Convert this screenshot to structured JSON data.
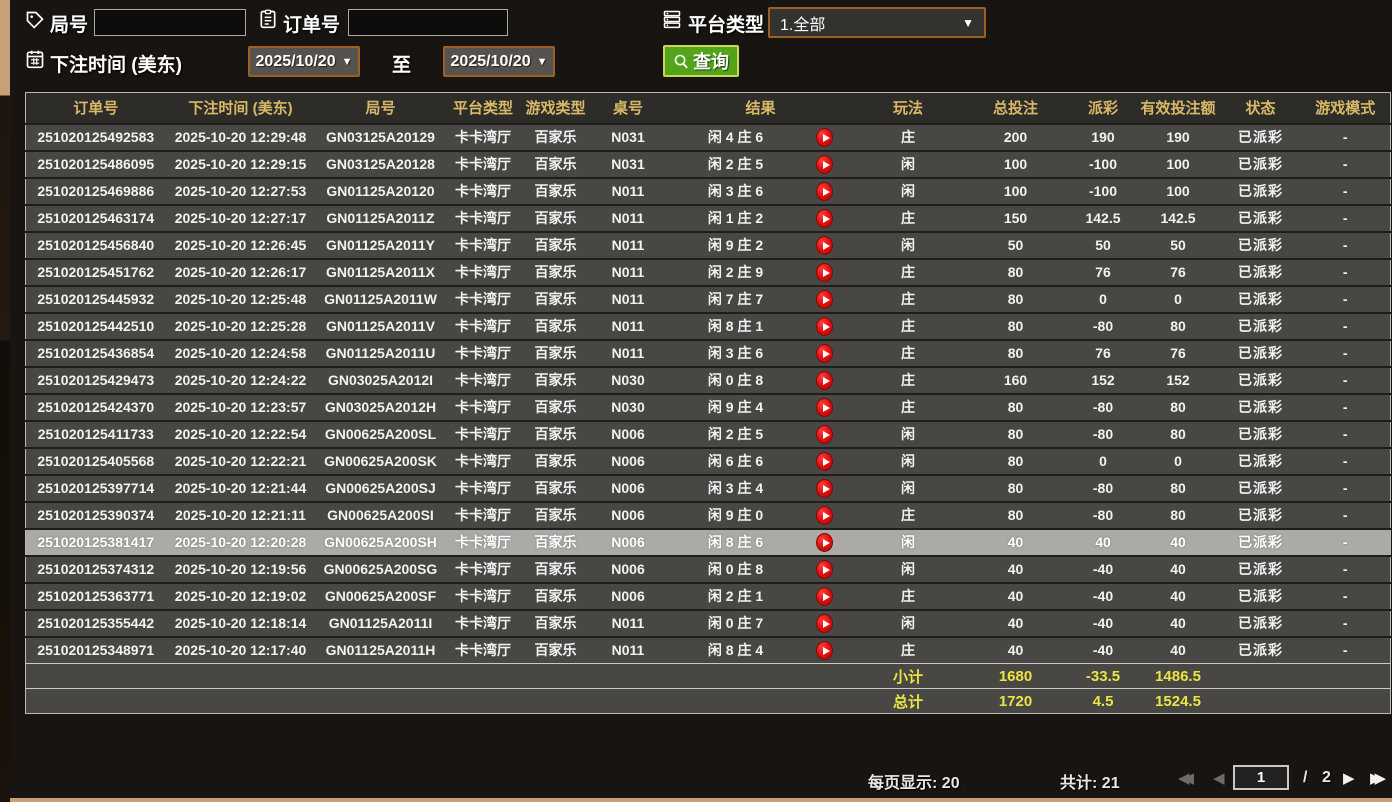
{
  "filters": {
    "game_no_label": "局号",
    "game_no_value": "",
    "order_no_label": "订单号",
    "order_no_value": "",
    "platform_label": "平台类型",
    "platform_value": "1.全部",
    "platform_caret": "▼",
    "bet_time_label": "下注时间 (美东)",
    "date_from": "2025/10/20",
    "date_to": "2025/10/20",
    "date_caret": "▼",
    "to_label": "至",
    "query_label": "查询"
  },
  "table": {
    "headers": [
      "订单号",
      "下注时间 (美东)",
      "局号",
      "平台类型",
      "游戏类型",
      "桌号",
      "结果",
      "玩法",
      "总投注",
      "派彩",
      "有效投注额",
      "状态",
      "游戏模式"
    ],
    "selected_row_index": 15,
    "rows": [
      {
        "order": "251020125492583",
        "time": "2025-10-20 12:29:48",
        "game_no": "GN03125A20129",
        "platform": "卡卡湾厅",
        "game_type": "百家乐",
        "table_no": "N031",
        "result": "闲 4 庄 6",
        "bet": "庄",
        "total_bet": "200",
        "payout": "190",
        "valid_bet": "190",
        "status": "已派彩",
        "mode": "-"
      },
      {
        "order": "251020125486095",
        "time": "2025-10-20 12:29:15",
        "game_no": "GN03125A20128",
        "platform": "卡卡湾厅",
        "game_type": "百家乐",
        "table_no": "N031",
        "result": "闲 2 庄 5",
        "bet": "闲",
        "total_bet": "100",
        "payout": "-100",
        "valid_bet": "100",
        "status": "已派彩",
        "mode": "-"
      },
      {
        "order": "251020125469886",
        "time": "2025-10-20 12:27:53",
        "game_no": "GN01125A20120",
        "platform": "卡卡湾厅",
        "game_type": "百家乐",
        "table_no": "N011",
        "result": "闲 3 庄 6",
        "bet": "闲",
        "total_bet": "100",
        "payout": "-100",
        "valid_bet": "100",
        "status": "已派彩",
        "mode": "-"
      },
      {
        "order": "251020125463174",
        "time": "2025-10-20 12:27:17",
        "game_no": "GN01125A2011Z",
        "platform": "卡卡湾厅",
        "game_type": "百家乐",
        "table_no": "N011",
        "result": "闲 1 庄 2",
        "bet": "庄",
        "total_bet": "150",
        "payout": "142.5",
        "valid_bet": "142.5",
        "status": "已派彩",
        "mode": "-"
      },
      {
        "order": "251020125456840",
        "time": "2025-10-20 12:26:45",
        "game_no": "GN01125A2011Y",
        "platform": "卡卡湾厅",
        "game_type": "百家乐",
        "table_no": "N011",
        "result": "闲 9 庄 2",
        "bet": "闲",
        "total_bet": "50",
        "payout": "50",
        "valid_bet": "50",
        "status": "已派彩",
        "mode": "-"
      },
      {
        "order": "251020125451762",
        "time": "2025-10-20 12:26:17",
        "game_no": "GN01125A2011X",
        "platform": "卡卡湾厅",
        "game_type": "百家乐",
        "table_no": "N011",
        "result": "闲 2 庄 9",
        "bet": "庄",
        "total_bet": "80",
        "payout": "76",
        "valid_bet": "76",
        "status": "已派彩",
        "mode": "-"
      },
      {
        "order": "251020125445932",
        "time": "2025-10-20 12:25:48",
        "game_no": "GN01125A2011W",
        "platform": "卡卡湾厅",
        "game_type": "百家乐",
        "table_no": "N011",
        "result": "闲 7 庄 7",
        "bet": "庄",
        "total_bet": "80",
        "payout": "0",
        "valid_bet": "0",
        "status": "已派彩",
        "mode": "-"
      },
      {
        "order": "251020125442510",
        "time": "2025-10-20 12:25:28",
        "game_no": "GN01125A2011V",
        "platform": "卡卡湾厅",
        "game_type": "百家乐",
        "table_no": "N011",
        "result": "闲 8 庄 1",
        "bet": "庄",
        "total_bet": "80",
        "payout": "-80",
        "valid_bet": "80",
        "status": "已派彩",
        "mode": "-"
      },
      {
        "order": "251020125436854",
        "time": "2025-10-20 12:24:58",
        "game_no": "GN01125A2011U",
        "platform": "卡卡湾厅",
        "game_type": "百家乐",
        "table_no": "N011",
        "result": "闲 3 庄 6",
        "bet": "庄",
        "total_bet": "80",
        "payout": "76",
        "valid_bet": "76",
        "status": "已派彩",
        "mode": "-"
      },
      {
        "order": "251020125429473",
        "time": "2025-10-20 12:24:22",
        "game_no": "GN03025A2012I",
        "platform": "卡卡湾厅",
        "game_type": "百家乐",
        "table_no": "N030",
        "result": "闲 0 庄 8",
        "bet": "庄",
        "total_bet": "160",
        "payout": "152",
        "valid_bet": "152",
        "status": "已派彩",
        "mode": "-"
      },
      {
        "order": "251020125424370",
        "time": "2025-10-20 12:23:57",
        "game_no": "GN03025A2012H",
        "platform": "卡卡湾厅",
        "game_type": "百家乐",
        "table_no": "N030",
        "result": "闲 9 庄 4",
        "bet": "庄",
        "total_bet": "80",
        "payout": "-80",
        "valid_bet": "80",
        "status": "已派彩",
        "mode": "-"
      },
      {
        "order": "251020125411733",
        "time": "2025-10-20 12:22:54",
        "game_no": "GN00625A200SL",
        "platform": "卡卡湾厅",
        "game_type": "百家乐",
        "table_no": "N006",
        "result": "闲 2 庄 5",
        "bet": "闲",
        "total_bet": "80",
        "payout": "-80",
        "valid_bet": "80",
        "status": "已派彩",
        "mode": "-"
      },
      {
        "order": "251020125405568",
        "time": "2025-10-20 12:22:21",
        "game_no": "GN00625A200SK",
        "platform": "卡卡湾厅",
        "game_type": "百家乐",
        "table_no": "N006",
        "result": "闲 6 庄 6",
        "bet": "闲",
        "total_bet": "80",
        "payout": "0",
        "valid_bet": "0",
        "status": "已派彩",
        "mode": "-"
      },
      {
        "order": "251020125397714",
        "time": "2025-10-20 12:21:44",
        "game_no": "GN00625A200SJ",
        "platform": "卡卡湾厅",
        "game_type": "百家乐",
        "table_no": "N006",
        "result": "闲 3 庄 4",
        "bet": "闲",
        "total_bet": "80",
        "payout": "-80",
        "valid_bet": "80",
        "status": "已派彩",
        "mode": "-"
      },
      {
        "order": "251020125390374",
        "time": "2025-10-20 12:21:11",
        "game_no": "GN00625A200SI",
        "platform": "卡卡湾厅",
        "game_type": "百家乐",
        "table_no": "N006",
        "result": "闲 9 庄 0",
        "bet": "庄",
        "total_bet": "80",
        "payout": "-80",
        "valid_bet": "80",
        "status": "已派彩",
        "mode": "-"
      },
      {
        "order": "251020125381417",
        "time": "2025-10-20 12:20:28",
        "game_no": "GN00625A200SH",
        "platform": "卡卡湾厅",
        "game_type": "百家乐",
        "table_no": "N006",
        "result": "闲 8 庄 6",
        "bet": "闲",
        "total_bet": "40",
        "payout": "40",
        "valid_bet": "40",
        "status": "已派彩",
        "mode": "-"
      },
      {
        "order": "251020125374312",
        "time": "2025-10-20 12:19:56",
        "game_no": "GN00625A200SG",
        "platform": "卡卡湾厅",
        "game_type": "百家乐",
        "table_no": "N006",
        "result": "闲 0 庄 8",
        "bet": "闲",
        "total_bet": "40",
        "payout": "-40",
        "valid_bet": "40",
        "status": "已派彩",
        "mode": "-"
      },
      {
        "order": "251020125363771",
        "time": "2025-10-20 12:19:02",
        "game_no": "GN00625A200SF",
        "platform": "卡卡湾厅",
        "game_type": "百家乐",
        "table_no": "N006",
        "result": "闲 2 庄 1",
        "bet": "庄",
        "total_bet": "40",
        "payout": "-40",
        "valid_bet": "40",
        "status": "已派彩",
        "mode": "-"
      },
      {
        "order": "251020125355442",
        "time": "2025-10-20 12:18:14",
        "game_no": "GN01125A2011I",
        "platform": "卡卡湾厅",
        "game_type": "百家乐",
        "table_no": "N011",
        "result": "闲 0 庄 7",
        "bet": "闲",
        "total_bet": "40",
        "payout": "-40",
        "valid_bet": "40",
        "status": "已派彩",
        "mode": "-"
      },
      {
        "order": "251020125348971",
        "time": "2025-10-20 12:17:40",
        "game_no": "GN01125A2011H",
        "platform": "卡卡湾厅",
        "game_type": "百家乐",
        "table_no": "N011",
        "result": "闲 8 庄 4",
        "bet": "庄",
        "total_bet": "40",
        "payout": "-40",
        "valid_bet": "40",
        "status": "已派彩",
        "mode": "-"
      }
    ],
    "subtotal": {
      "label": "小计",
      "total_bet": "1680",
      "payout": "-33.5",
      "valid_bet": "1486.5"
    },
    "total": {
      "label": "总计",
      "total_bet": "1720",
      "payout": "4.5",
      "valid_bet": "1524.5"
    }
  },
  "footer": {
    "page_size_label": "每页显示:",
    "page_size": "20",
    "total_label": "共计:",
    "total_count": "21",
    "current_page": "1",
    "page_separator": "/",
    "total_pages": "2",
    "first_icon": "◀◀",
    "prev_icon": "◀",
    "next_icon": "▶",
    "last_icon": "▶▶"
  },
  "colors": {
    "header_text": "#d9b967",
    "win_red": "#d02433",
    "loss_green": "#3ed63e",
    "status_green": "#3cc63c",
    "summary_yellow": "#e9e642",
    "query_button_green": "#52a518",
    "date_border_orange": "#9a6120",
    "selected_row_bg": "#acaaa7"
  }
}
